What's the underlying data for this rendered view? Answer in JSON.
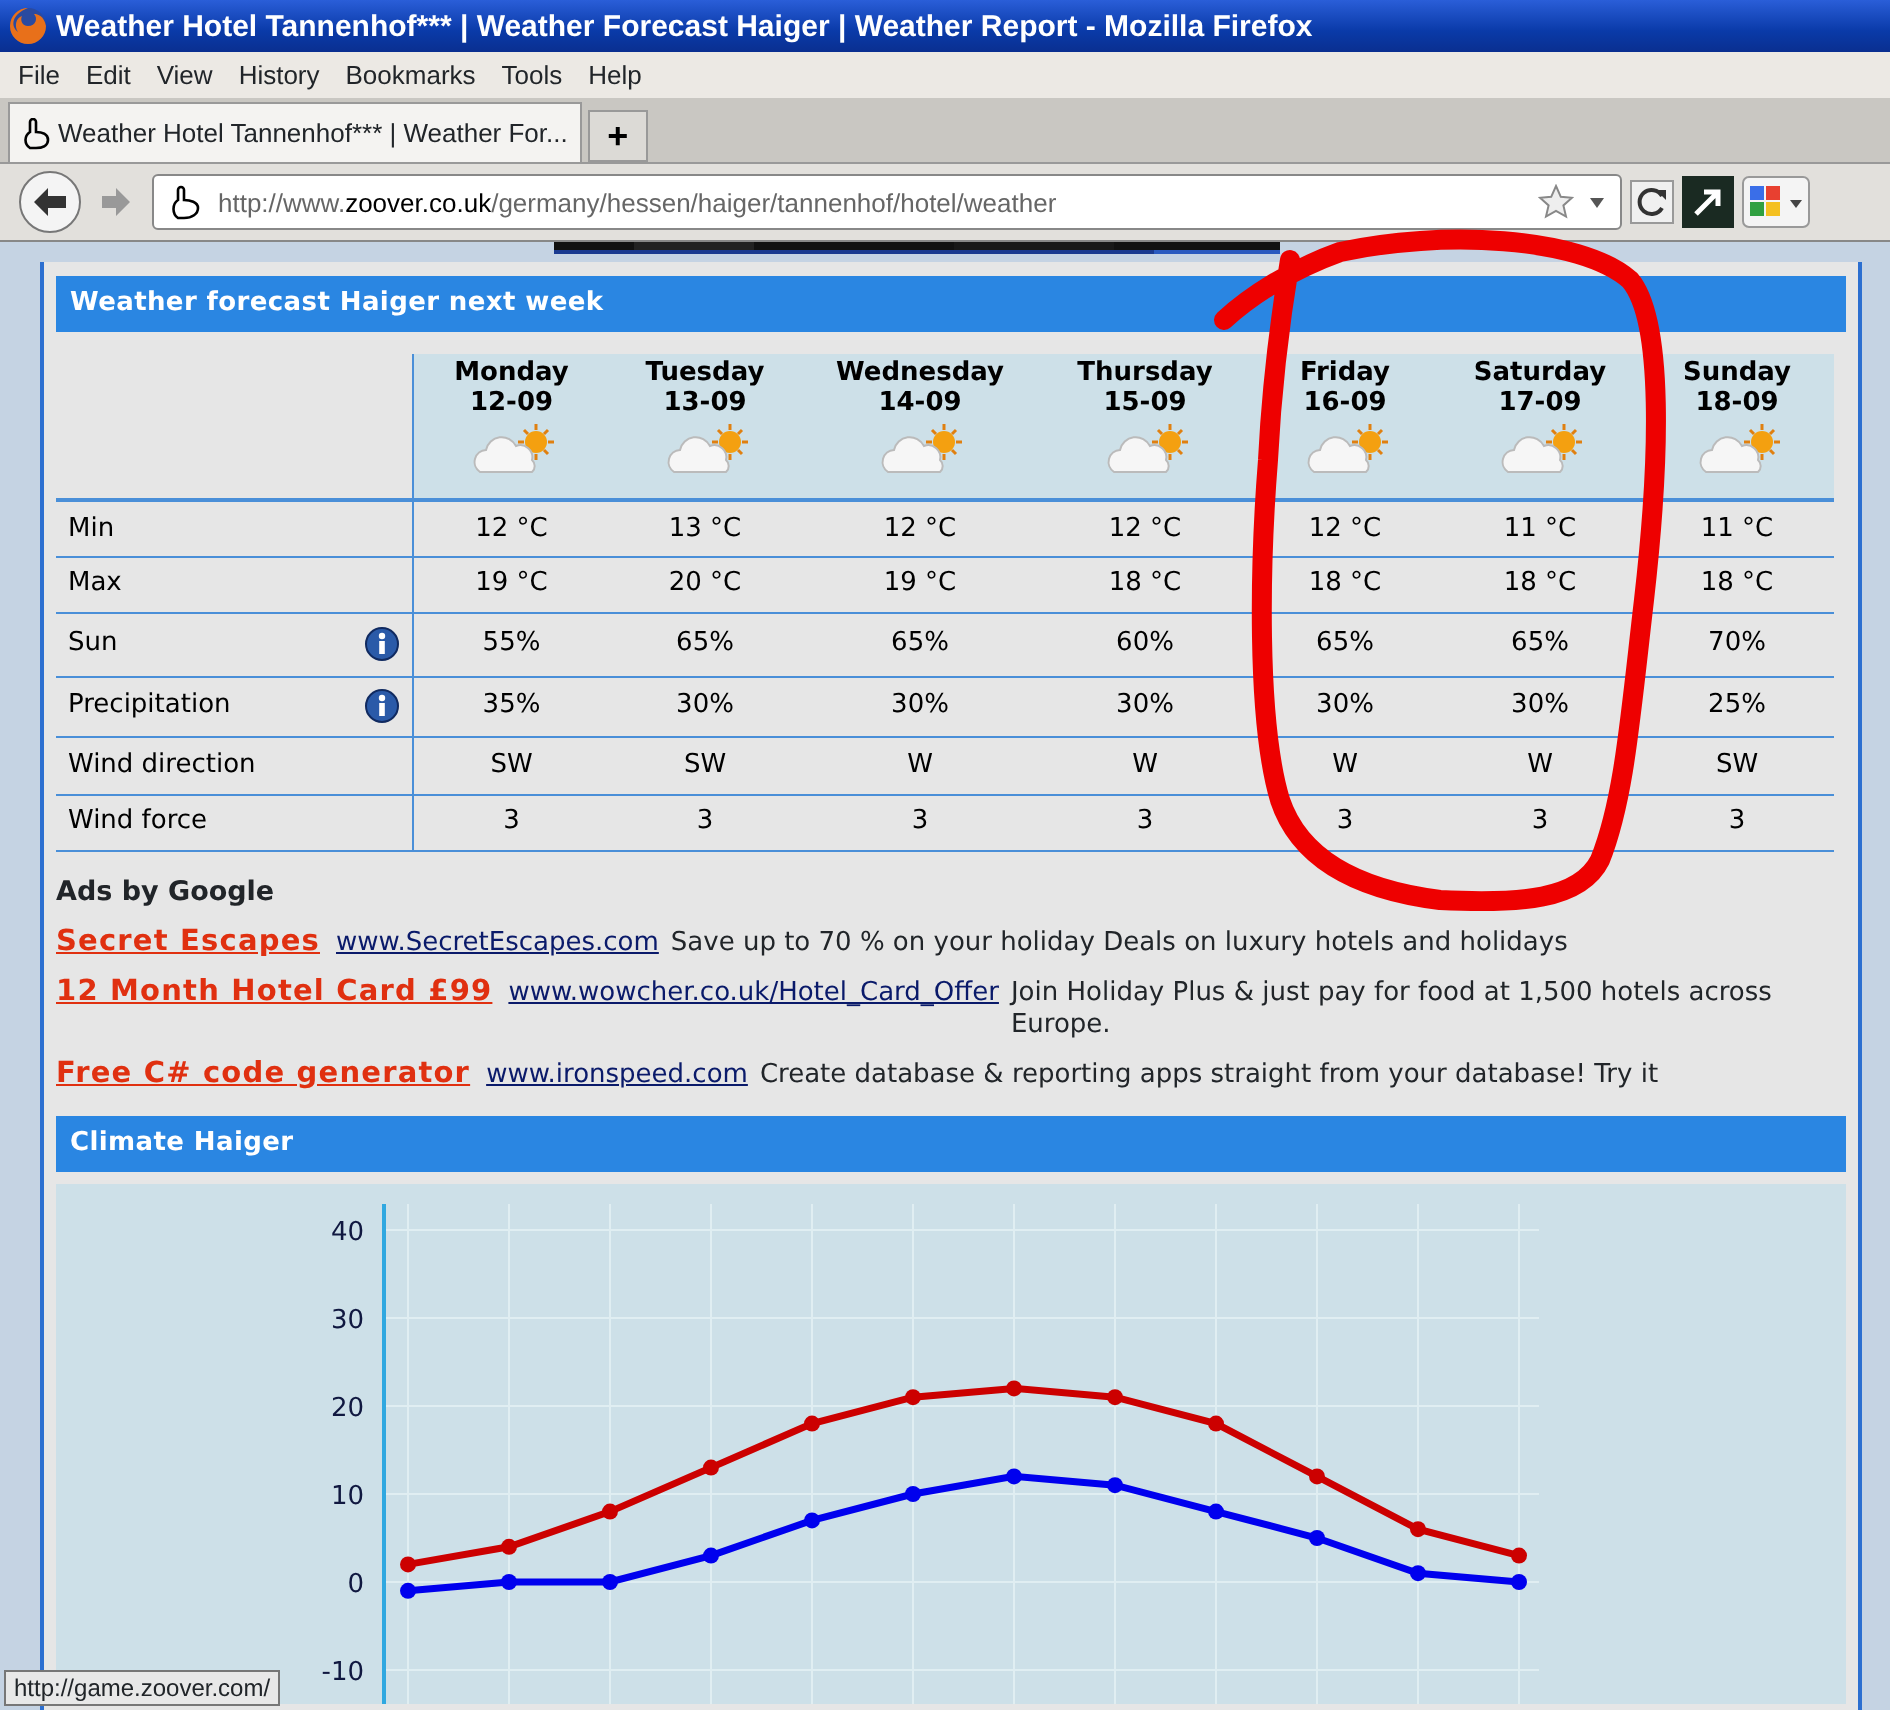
{
  "window": {
    "title": "Weather Hotel Tannenhof*** | Weather Forecast Haiger | Weather Report - Mozilla Firefox"
  },
  "menu": [
    "File",
    "Edit",
    "View",
    "History",
    "Bookmarks",
    "Tools",
    "Help"
  ],
  "tabs": [
    {
      "label": "Weather Hotel Tannenhof*** | Weather For...",
      "selected": true
    }
  ],
  "new_tab_button": "+",
  "address_bar": {
    "url": "http://www.**zoover.co.uk**/germany/hessen/haiger/tannenhof/hotel/weather"
  },
  "forecast": {
    "title": "Weather forecast Haiger next week",
    "columns": [
      {
        "day": "Monday",
        "date": "12-09"
      },
      {
        "day": "Tuesday",
        "date": "13-09"
      },
      {
        "day": "Wednesday",
        "date": "14-09"
      },
      {
        "day": "Thursday",
        "date": "15-09"
      },
      {
        "day": "Friday",
        "date": "16-09"
      },
      {
        "day": "Saturday",
        "date": "17-09"
      },
      {
        "day": "Sunday",
        "date": "18-09"
      }
    ],
    "rows": [
      {
        "label": "Min",
        "info": false,
        "values": [
          "12 °C",
          "13 °C",
          "12 °C",
          "12 °C",
          "12 °C",
          "11 °C",
          "11 °C"
        ]
      },
      {
        "label": "Max",
        "info": false,
        "values": [
          "19 °C",
          "20 °C",
          "19 °C",
          "18 °C",
          "18 °C",
          "18 °C",
          "18 °C"
        ]
      },
      {
        "label": "Sun",
        "info": true,
        "values": [
          "55%",
          "65%",
          "65%",
          "60%",
          "65%",
          "65%",
          "70%"
        ]
      },
      {
        "label": "Precipitation",
        "info": true,
        "values": [
          "35%",
          "30%",
          "30%",
          "30%",
          "30%",
          "30%",
          "25%"
        ]
      },
      {
        "label": "Wind direction",
        "info": false,
        "values": [
          "SW",
          "SW",
          "W",
          "W",
          "W",
          "W",
          "SW"
        ]
      },
      {
        "label": "Wind force",
        "info": false,
        "values": [
          "3",
          "3",
          "3",
          "3",
          "3",
          "3",
          "3"
        ]
      }
    ]
  },
  "ads": {
    "title": "Ads by Google",
    "items": [
      {
        "title": "Secret Escapes",
        "url": "www.SecretEscapes.com",
        "text": "Save up to 70 % on your holiday Deals on luxury hotels and holidays"
      },
      {
        "title": "12 Month Hotel Card £99",
        "url": "www.wowcher.co.uk/Hotel_Card_Offer",
        "text": "Join Holiday Plus & just pay for food at 1,500 hotels across Europe."
      },
      {
        "title": "Free C# code generator",
        "url": "www.ironspeed.com",
        "text": "Create database & reporting apps straight from your database! Try it"
      }
    ]
  },
  "climate": {
    "title": "Climate Haiger",
    "chart_data": {
      "type": "line",
      "ylim": [
        -10,
        40
      ],
      "grid": true,
      "yticks": [
        -10,
        0,
        10,
        20,
        30,
        40
      ],
      "series": [
        {
          "color": "#cc0000",
          "marker": true,
          "values": [
            2,
            4,
            8,
            13,
            18,
            21,
            22,
            21,
            18,
            12,
            6,
            3
          ]
        },
        {
          "color": "#0000ee",
          "marker": true,
          "values": [
            -1,
            0,
            0,
            3,
            7,
            10,
            12,
            11,
            8,
            5,
            1,
            0
          ]
        }
      ]
    }
  },
  "status_tooltip": "http://game.zoover.com/"
}
